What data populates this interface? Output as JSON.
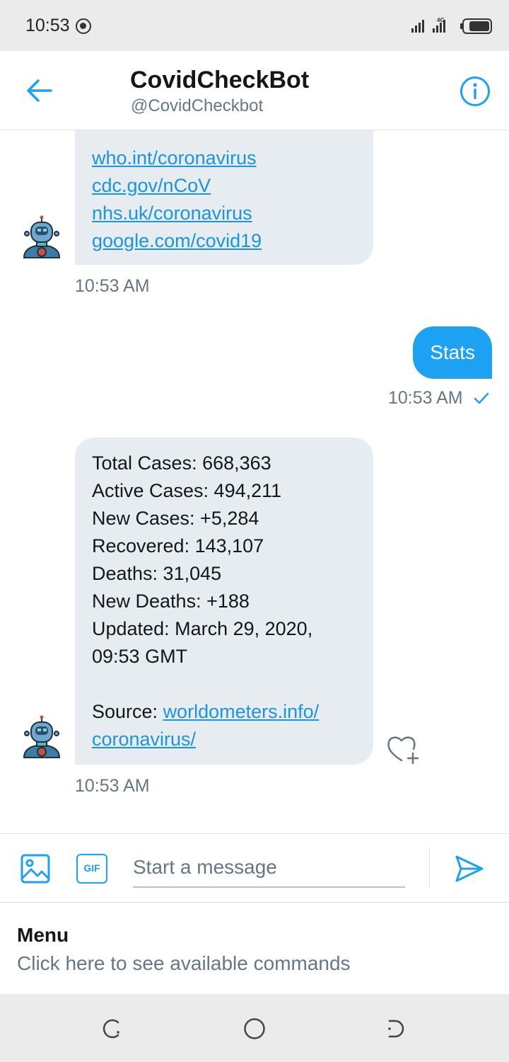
{
  "status_bar": {
    "time": "10:53",
    "network": "4G"
  },
  "header": {
    "name": "CovidCheckBot",
    "handle": "@CovidCheckbot"
  },
  "messages": [
    {
      "from": "bot",
      "links": [
        "who.int/coronavirus",
        "cdc.gov/nCoV",
        "nhs.uk/coronavirus",
        "google.com/covid19"
      ],
      "time": "10:53 AM"
    },
    {
      "from": "me",
      "text": "Stats",
      "time": "10:53 AM"
    },
    {
      "from": "bot",
      "lines": [
        "Total Cases: 668,363",
        "Active Cases: 494,211",
        "New Cases: +5,284",
        "Recovered: 143,107",
        "Deaths: 31,045",
        "New Deaths: +188",
        "Updated: March 29, 2020,",
        "09:53 GMT"
      ],
      "source_label": "Source: ",
      "source_link_1": "worldometers.info/",
      "source_link_2": "coronavirus/",
      "time": "10:53 AM"
    }
  ],
  "composer": {
    "gif_label": "GIF",
    "placeholder": "Start a message"
  },
  "menu": {
    "title": "Menu",
    "subtitle": "Click here to see available commands"
  },
  "colors": {
    "accent": "#1da1f2",
    "link": "#1b95e0",
    "bubble_bot": "#e6ecf0",
    "muted": "#657786"
  }
}
